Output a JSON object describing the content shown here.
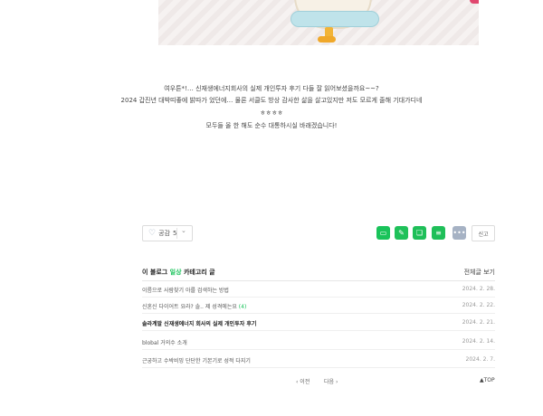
{
  "post": {
    "line1": "여우튼*!… 신재생에너지회사의 실제 개인투자 후기 다들 잘 읽어보셨을까요~~?",
    "line2": "2024 갑진년 대박띠좋에 밝따가 었던에… 물론 서클도 방상 감사한 삶을 살고있지만 저도 모르게 줄해 기대가디네",
    "line3": "ㅎㅎㅎㅎ",
    "line4": "모두들 올 한 해도 순수 대통하시실 바래겠습니다!"
  },
  "actions": {
    "like_label": "공감",
    "like_count": "5",
    "report_label": "신고"
  },
  "category": {
    "prefix": "이 블로그 ",
    "name": "일상",
    "suffix": " 카테고리 글",
    "view_all": "전체글 보기",
    "posts": [
      {
        "title": "이름으로 사람찾기 아를 검색하는 방법",
        "comments": "",
        "date": "2024. 2. 28."
      },
      {
        "title": "신혼신 다이어트 요라? 솔.. 제 성격에는요",
        "comments": "(4)",
        "date": "2024. 2. 22."
      },
      {
        "title": "솔라계발 신재생에너지 회사의 실제 개인투자 후기",
        "comments": "",
        "date": "2024. 2. 21."
      },
      {
        "title": "blobal 거의수 소개",
        "comments": "",
        "date": "2024. 2. 14."
      },
      {
        "title": "근궁하고 수박비밍 단단한 기본기로 성적 다지기",
        "comments": "",
        "date": "2024. 2. 7."
      }
    ]
  },
  "pager": {
    "prev": "‹ 이전",
    "next": "다음 ›",
    "top": "▲TOP"
  }
}
